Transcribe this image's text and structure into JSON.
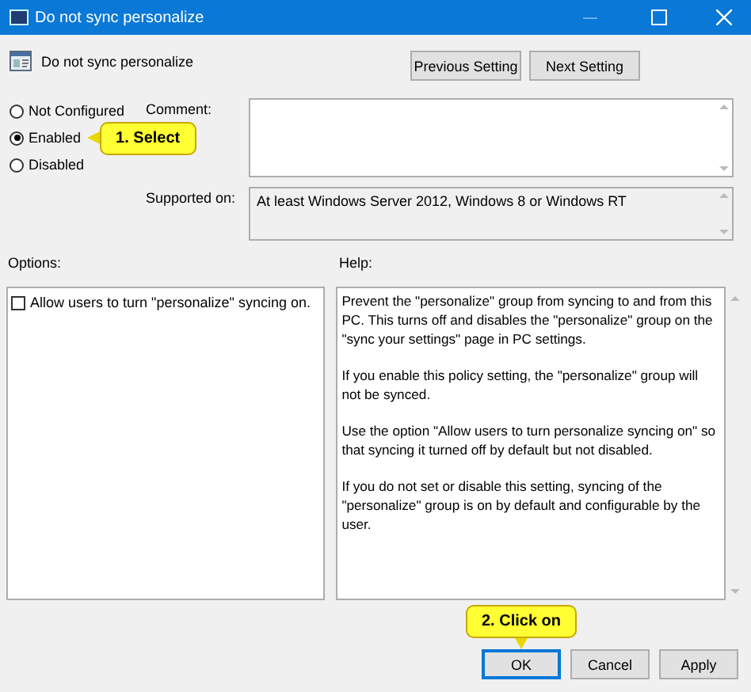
{
  "window": {
    "title": "Do not sync personalize"
  },
  "header": {
    "title": "Do not sync personalize"
  },
  "nav_buttons": [
    {
      "label": "Previous Setting"
    },
    {
      "label": "Next Setting"
    }
  ],
  "state_options": [
    {
      "label": "Not Configured",
      "selected": false
    },
    {
      "label": "Enabled",
      "selected": true
    },
    {
      "label": "Disabled",
      "selected": false
    }
  ],
  "comment": {
    "label": "Comment:"
  },
  "supported_on": {
    "label": "Supported on:",
    "value": "At least Windows Server 2012, Windows 8 or Windows RT"
  },
  "options": {
    "label": "Options:",
    "items": [
      {
        "label": "Allow users to turn \"personalize\" syncing on.",
        "checked": false
      }
    ]
  },
  "help": {
    "label": "Help:",
    "paragraphs": [
      "Prevent the \"personalize\" group from syncing to and from this PC.  This turns off and disables the \"personalize\" group on the \"sync your settings\" page in PC settings.",
      "If you enable this policy setting, the \"personalize\" group will not be synced.",
      "Use the option \"Allow users to turn personalize syncing on\" so that syncing it turned off by default but not disabled.",
      "If you do not set or disable this setting, syncing of the \"personalize\" group is on by default and configurable by the user."
    ]
  },
  "footer_buttons": [
    {
      "label": "OK",
      "selected": true
    },
    {
      "label": "Cancel",
      "selected": false
    },
    {
      "label": "Apply",
      "selected": false
    }
  ],
  "callouts": [
    {
      "text": "1. Select",
      "kind": "left"
    },
    {
      "text": "2. Click on",
      "kind": "down"
    }
  ]
}
